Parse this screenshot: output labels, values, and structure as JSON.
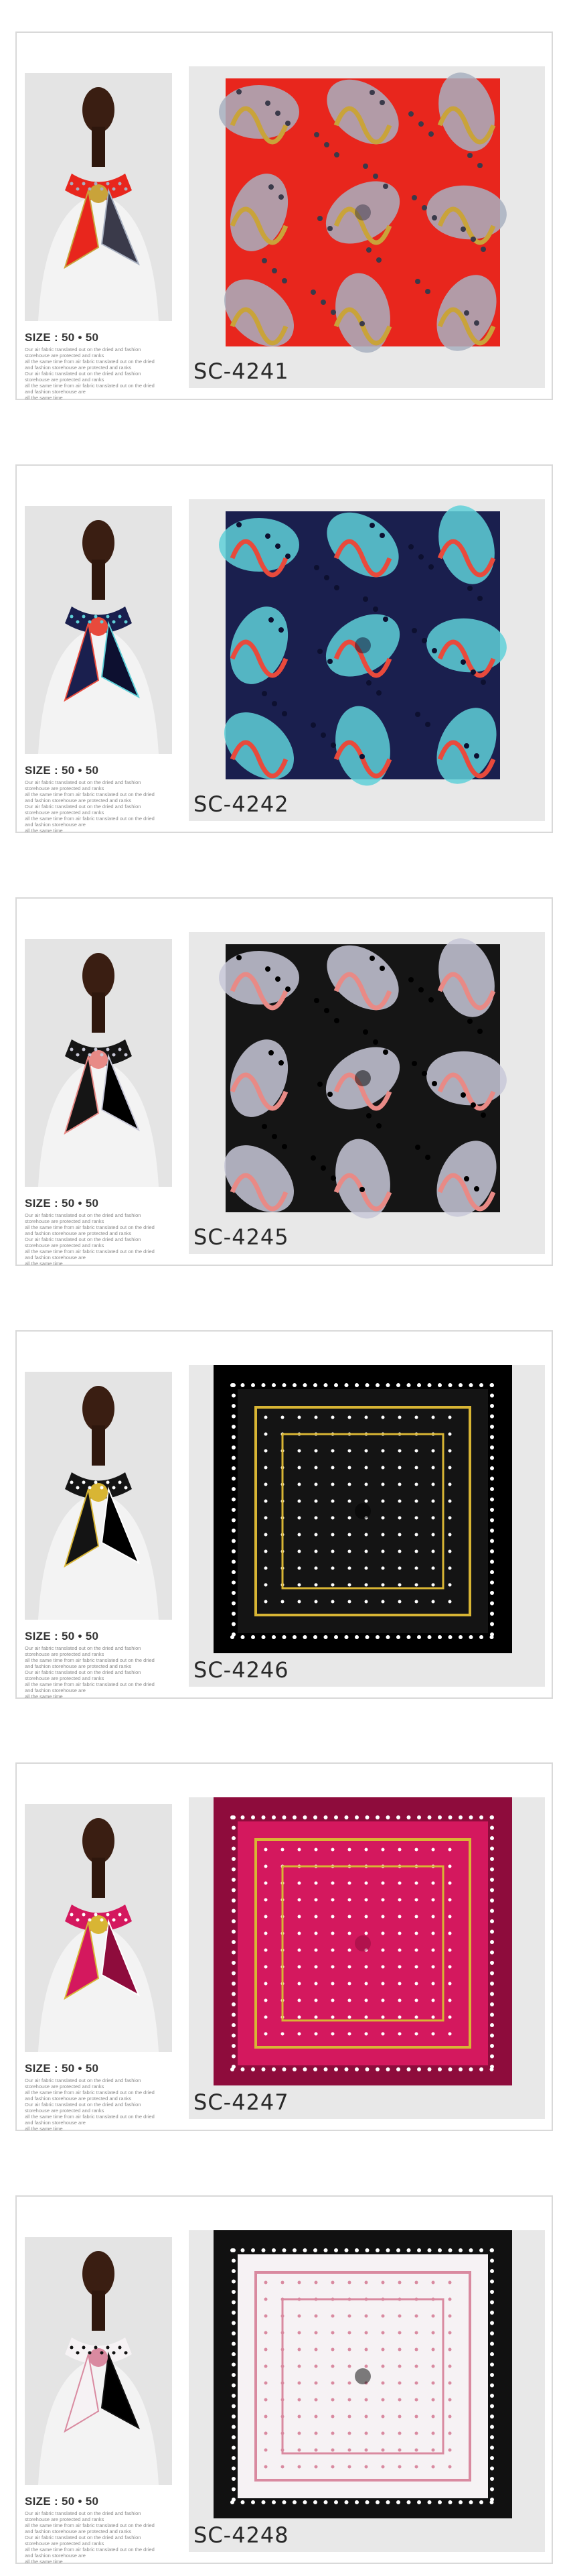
{
  "products": [
    {
      "sku": "SC-4241",
      "size": "SIZE : 50 • 50",
      "desc": [
        "Our air fabric translated out on the dried and fashion",
        "storehouse are protected and ranks",
        "all the same time from air fabric translated out on the dried",
        "and fashion storehouse are protected and ranks",
        "Our air fabric translated out on the dried and fashion",
        "storehouse are protected and ranks",
        "all the same time from air fabric translated out on the dried",
        "and fashion storehouse are",
        "all the same time"
      ],
      "colors": {
        "base": "#e8261d",
        "accent": "#c9a33a",
        "second": "#a8b0c0",
        "dark": "#3a3a4a"
      }
    },
    {
      "sku": "SC-4242",
      "size": "SIZE : 50 • 50",
      "desc": [
        "Our air fabric translated out on the dried and fashion",
        "storehouse are protected and ranks",
        "all the same time from air fabric translated out on the dried",
        "and fashion storehouse are protected and ranks",
        "Our air fabric translated out on the dried and fashion",
        "storehouse are protected and ranks",
        "all the same time from air fabric translated out on the dried",
        "and fashion storehouse are",
        "all the same time"
      ],
      "colors": {
        "base": "#1a1f4e",
        "accent": "#e84a3c",
        "second": "#5fd0d8",
        "dark": "#0d1030"
      }
    },
    {
      "sku": "SC-4245",
      "size": "SIZE : 50 • 50",
      "desc": [
        "Our air fabric translated out on the dried and fashion",
        "storehouse are protected and ranks",
        "all the same time from air fabric translated out on the dried",
        "and fashion storehouse are protected and ranks",
        "Our air fabric translated out on the dried and fashion",
        "storehouse are protected and ranks",
        "all the same time from air fabric translated out on the dried",
        "and fashion storehouse are",
        "all the same time"
      ],
      "colors": {
        "base": "#151515",
        "accent": "#e88a86",
        "second": "#c8c8d8",
        "dark": "#000000"
      }
    },
    {
      "sku": "SC-4246",
      "size": "SIZE : 50 • 50",
      "desc": [
        "Our air fabric translated out on the dried and fashion",
        "storehouse are protected and ranks",
        "all the same time from air fabric translated out on the dried",
        "and fashion storehouse are protected and ranks",
        "Our air fabric translated out on the dried and fashion",
        "storehouse are protected and ranks",
        "all the same time from air fabric translated out on the dried",
        "and fashion storehouse are",
        "all the same time"
      ],
      "colors": {
        "base": "#141414",
        "accent": "#d8b534",
        "second": "#ffffff",
        "dark": "#000000"
      }
    },
    {
      "sku": "SC-4247",
      "size": "SIZE : 50 • 50",
      "desc": [
        "Our air fabric translated out on the dried and fashion",
        "storehouse are protected and ranks",
        "all the same time from air fabric translated out on the dried",
        "and fashion storehouse are protected and ranks",
        "Our air fabric translated out on the dried and fashion",
        "storehouse are protected and ranks",
        "all the same time from air fabric translated out on the dried",
        "and fashion storehouse are",
        "all the same time"
      ],
      "colors": {
        "base": "#d4185e",
        "accent": "#d8b534",
        "second": "#ffffff",
        "dark": "#8e0c3c"
      }
    },
    {
      "sku": "SC-4248",
      "size": "SIZE : 50 • 50",
      "desc": [
        "Our air fabric translated out on the dried and fashion",
        "storehouse are protected and ranks",
        "all the same time from air fabric translated out on the dried",
        "and fashion storehouse are protected and ranks",
        "Our air fabric translated out on the dried and fashion",
        "storehouse are protected and ranks",
        "all the same time from air fabric translated out on the dried",
        "and fashion storehouse are",
        "all the same time"
      ],
      "colors": {
        "base": "#f6f2f4",
        "accent": "#d98aa0",
        "second": "#111111",
        "dark": "#000000"
      }
    }
  ]
}
